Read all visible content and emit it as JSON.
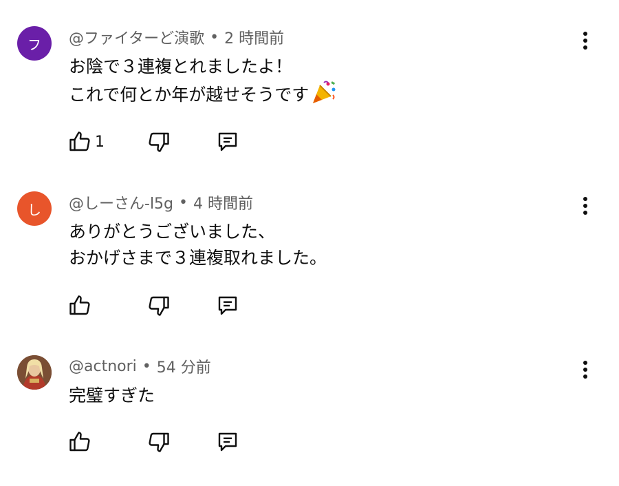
{
  "comments": [
    {
      "avatar_letter": "フ",
      "avatar_color": "#6a1fa8",
      "author": "@ファイターど演歌",
      "separator": "•",
      "time": "2 時間前",
      "lines": [
        "お陰で３連複とれましたよ！",
        "これで何とか年が越せそうです"
      ],
      "emoji_icon": "party-popper-icon",
      "likes": "1"
    },
    {
      "avatar_letter": "し",
      "avatar_color": "#e8552b",
      "author": "@しーさん-l5g",
      "separator": "•",
      "time": "4 時間前",
      "lines": [
        "ありがとうございました、",
        "おかげさまで３連複取れました。"
      ],
      "likes": ""
    },
    {
      "avatar_letter": "",
      "avatar_color": "#8a5a3c",
      "author": "@actnori",
      "separator": "•",
      "time": "54 分前",
      "lines": [
        "完璧すぎた"
      ],
      "likes": ""
    }
  ],
  "icons": {
    "like": "thumbs-up-icon",
    "dislike": "thumbs-down-icon",
    "reply": "reply-icon",
    "menu": "more-vertical-icon"
  }
}
